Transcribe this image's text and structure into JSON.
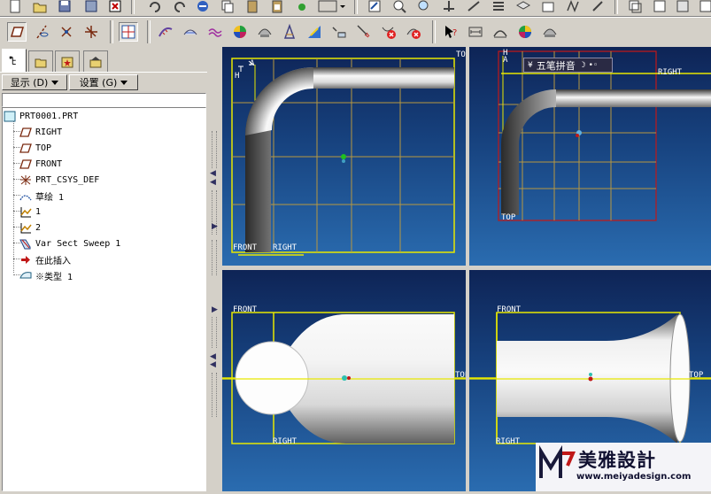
{
  "toolbar": {
    "row1_icons": [
      "new-icon",
      "open-icon",
      "save-icon",
      "save-as-icon",
      "close-window-icon",
      "undo-icon",
      "redo-icon",
      "regenerate-icon",
      "copy-icon",
      "paste-icon",
      "paste-special-icon",
      "mapkey-icon",
      "view-manager-icon",
      "repaint-icon",
      "zoom-window-icon",
      "zoom-out-icon",
      "spin-center-icon",
      "orient-icon",
      "saved-views-icon",
      "layer-icon",
      "model-display-icon",
      "view-1-icon",
      "view-2-icon",
      "view-3-icon"
    ],
    "row2_icons": [
      "datum-plane-icon",
      "datum-axis-icon",
      "datum-point-icon",
      "datum-csys-icon",
      "grid-view-icon",
      "curvature-icon",
      "reflection-icon",
      "slope-icon",
      "shade-icon",
      "draft-check-icon",
      "section-icon",
      "offset-icon",
      "deviation-icon",
      "delete-analysis-icon",
      "clear-analysis-icon",
      "whats-this-icon",
      "measure-distance-icon",
      "measure-area-icon",
      "color-icon",
      "appearance-icon"
    ]
  },
  "panel": {
    "tabs": [
      "model-tree-tab",
      "folder-browser-tab",
      "favorites-tab",
      "connections-tab"
    ],
    "show_menu": "显示 (D)",
    "settings_menu": "设置 (G)"
  },
  "tree": {
    "items": [
      {
        "label": "PRT0001.PRT",
        "icon": "part-icon"
      },
      {
        "label": "RIGHT",
        "icon": "datum-plane-icon"
      },
      {
        "label": "TOP",
        "icon": "datum-plane-icon"
      },
      {
        "label": "FRONT",
        "icon": "datum-plane-icon"
      },
      {
        "label": "PRT_CSYS_DEF",
        "icon": "csys-icon"
      },
      {
        "label": "草绘 1",
        "icon": "sketch-icon"
      },
      {
        "label": "1",
        "icon": "datum-curve-icon"
      },
      {
        "label": "2",
        "icon": "datum-curve-icon"
      },
      {
        "label": "Var Sect Sweep 1",
        "icon": "sweep-icon"
      },
      {
        "label": "在此插入",
        "icon": "insert-here-icon"
      },
      {
        "label": "※类型 1",
        "icon": "feature-icon"
      }
    ]
  },
  "viewports": {
    "top_left": {
      "labels": {
        "top": "TOP",
        "front": "FRONT",
        "right": "RIGHT",
        "h": "H",
        "a": "A"
      }
    },
    "top_right": {
      "labels": {
        "right": "RIGHT",
        "top": "TOP",
        "h": "H",
        "a": "A"
      }
    },
    "bottom_left": {
      "labels": {
        "front": "FRONT",
        "top": "TOP",
        "right": "RIGHT"
      }
    },
    "bottom_right": {
      "labels": {
        "front": "FRONT",
        "top": "TOP",
        "right": "RIGHT"
      }
    }
  },
  "ime": {
    "text": "五笔拼音"
  },
  "watermark": {
    "brand": "美雅設計",
    "url": "www.meiyadesign.com"
  },
  "colors": {
    "datum_yellow": "#e8e800",
    "datum_red": "#c01818",
    "grid": "#b89840",
    "bg_top": "#0e2456",
    "bg_bottom": "#2a6cb0"
  }
}
